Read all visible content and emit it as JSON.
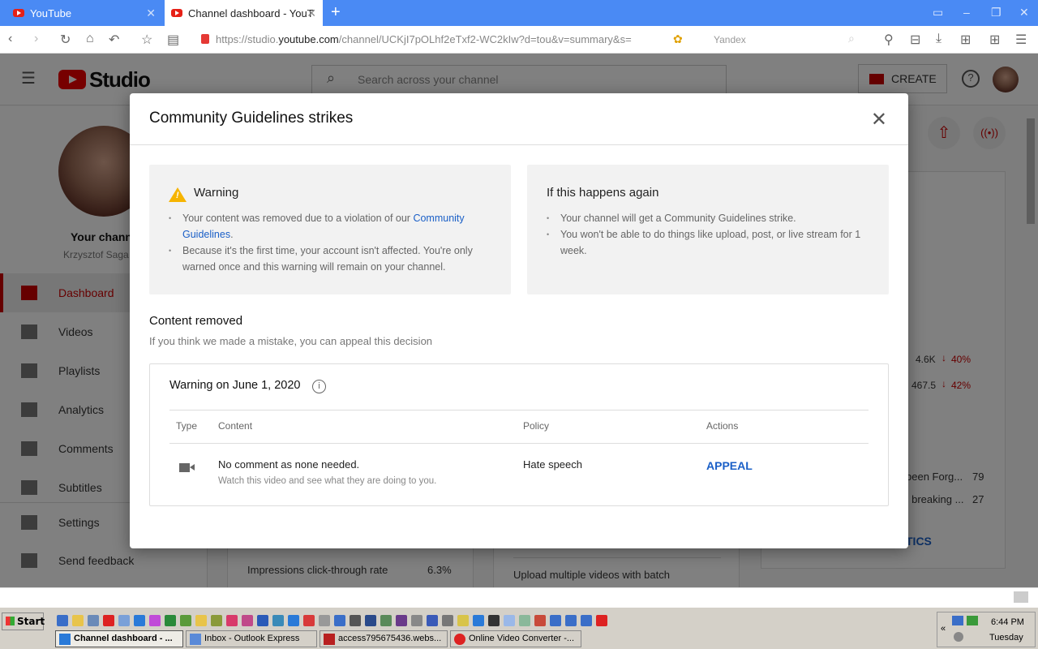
{
  "browser": {
    "tabs": [
      {
        "label": "YouTube"
      },
      {
        "label": "Channel dashboard - YouT"
      }
    ],
    "url_prefix": "https://studio.",
    "url_domain": "youtube.com",
    "url_path": "/channel/UCKjI7pOLhf2eTxf2-WC2kIw?d=tou&v=summary&s=",
    "search_engine": "Yandex"
  },
  "studio": {
    "logo_text": "Studio",
    "search_placeholder": "Search across your channel",
    "create_label": "CREATE",
    "channel_label": "Your channel",
    "channel_name": "Krzysztof Saga",
    "nav": [
      {
        "label": "Dashboard"
      },
      {
        "label": "Videos"
      },
      {
        "label": "Playlists"
      },
      {
        "label": "Analytics"
      },
      {
        "label": "Comments"
      },
      {
        "label": "Subtitles"
      },
      {
        "label": "Settings"
      },
      {
        "label": "Send feedback"
      }
    ],
    "stats": [
      {
        "value": "4.6K",
        "change": "40%"
      },
      {
        "value": "467.5",
        "change": "42%"
      }
    ],
    "top_videos": [
      {
        "title": "been Forg...",
        "value": "79"
      },
      {
        "title": "s breaking ...",
        "value": "27"
      }
    ],
    "analytics_link": "TICS",
    "ctr_label": "Impressions click-through rate",
    "ctr_value": "6.3%",
    "tip_text": "Upload multiple videos with batch"
  },
  "modal": {
    "title": "Community Guidelines strikes",
    "warning": {
      "heading": "Warning",
      "item1_text": "Your content was removed due to a violation of our ",
      "item1_link": "Community Guidelines",
      "item1_end": ".",
      "item2": "Because it's the first time, your account isn't affected. You're only warned once and this warning will remain on your channel."
    },
    "again": {
      "heading": "If this happens again",
      "items": [
        "Your channel will get a Community Guidelines strike.",
        "You won't be able to do things like upload, post, or live stream for 1 week."
      ]
    },
    "content_removed": "Content removed",
    "appeal_hint": "If you think we made a mistake, you can appeal this decision",
    "table": {
      "title": "Warning on June 1, 2020",
      "headers": [
        "Type",
        "Content",
        "Policy",
        "Actions"
      ],
      "row": {
        "type_icon": "video-camera-icon",
        "title": "No comment as none needed.",
        "description": "Watch this video and see what they are doing to you.",
        "policy": "Hate speech",
        "action": "APPEAL"
      }
    }
  },
  "taskbar": {
    "start": "Start",
    "quicklaunch_colors": [
      "#3a6ec8",
      "#e8c44a",
      "#6a8ab8",
      "#d22",
      "#7aa0d8",
      "#2a7ad8",
      "#c04ad8",
      "#2a8a3a",
      "#5a9a3a",
      "#e8c44a",
      "#8a9a3a",
      "#d83a6a",
      "#c04a8a",
      "#2a5ab8",
      "#3a8ab8",
      "#2a7ad8",
      "#d83a3a",
      "#999",
      "#3a6ec8",
      "#555",
      "#2a4a8a",
      "#5a8a5a",
      "#6a3a8a",
      "#888",
      "#3a5ab8",
      "#777",
      "#d8c44a",
      "#2a7ad8",
      "#333",
      "#9ab8e8",
      "#8ab89a",
      "#c84a3a",
      "#3a6ec8",
      "#3a6ec8",
      "#3a6ec8",
      "#d22"
    ],
    "tasks": [
      {
        "label": "Channel dashboard - ...",
        "color": "#2a7ad8"
      },
      {
        "label": "Inbox - Outlook Express",
        "color": "#5a8ad8"
      },
      {
        "label": "access795675436.webs...",
        "color": "#b82020"
      },
      {
        "label": "Online Video Converter -...",
        "color": "#d22"
      }
    ],
    "time": "6:44 PM",
    "day": "Tuesday"
  }
}
